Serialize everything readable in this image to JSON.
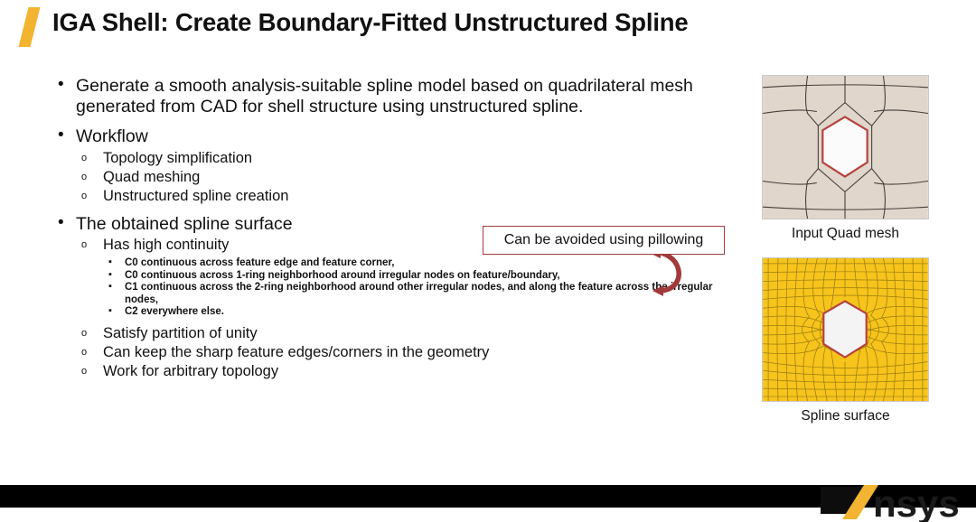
{
  "slide": {
    "title": "IGA Shell: Create Boundary-Fitted Unstructured Spline",
    "accent_color": "#f2b431",
    "footer_bar_color": "#000000"
  },
  "content": {
    "bullet_marker": "•",
    "circle_marker": "o",
    "dash_marker": "▪",
    "bullets": [
      {
        "level": 1,
        "text": "Generate a smooth analysis-suitable spline model based on quadrilateral mesh generated from CAD for shell structure using unstructured spline."
      },
      {
        "level": 1,
        "text": "Workflow"
      },
      {
        "level": 2,
        "text": "Topology simplification"
      },
      {
        "level": 2,
        "text": "Quad meshing"
      },
      {
        "level": 2,
        "text": "Unstructured spline creation"
      },
      {
        "level": 1,
        "text": "The obtained spline surface"
      },
      {
        "level": 2,
        "text": "Has high continuity"
      },
      {
        "level": 3,
        "text": "C0 continuous across feature edge and feature corner,"
      },
      {
        "level": 3,
        "text": "C0 continuous across 1-ring neighborhood around irregular nodes on feature/boundary,"
      },
      {
        "level": 3,
        "text": "C1 continuous across the 2-ring neighborhood around other irregular nodes, and along the feature across the irregular nodes,"
      },
      {
        "level": 3,
        "text": "C2 everywhere else."
      },
      {
        "level": 2,
        "text": "Satisfy partition of unity"
      },
      {
        "level": 2,
        "text": "Can keep the sharp feature edges/corners in the geometry"
      },
      {
        "level": 2,
        "text": "Work for arbitrary topology"
      }
    ]
  },
  "callout": {
    "text": "Can be avoided using pillowing",
    "border_color": "#a33a3a",
    "arrow_color": "#a33a3a"
  },
  "figures": [
    {
      "name": "input-quad-mesh",
      "caption": "Input Quad mesh",
      "surface_color": "#e0d6cb",
      "grid_color": "#4a4440",
      "hole_color": "#ffffff",
      "hole_outline_color": "#b5413d"
    },
    {
      "name": "spline-surface",
      "caption": "Spline surface",
      "surface_color": "#f7c41c",
      "grid_color": "#9a7d10",
      "hole_color": "#f4f4f4",
      "hole_outline_color": "#b5413d"
    }
  ],
  "footer": {
    "logo_text": "nsys",
    "logo_accent_color": "#f2b431",
    "logo_text_color": "#1a1a1a"
  }
}
